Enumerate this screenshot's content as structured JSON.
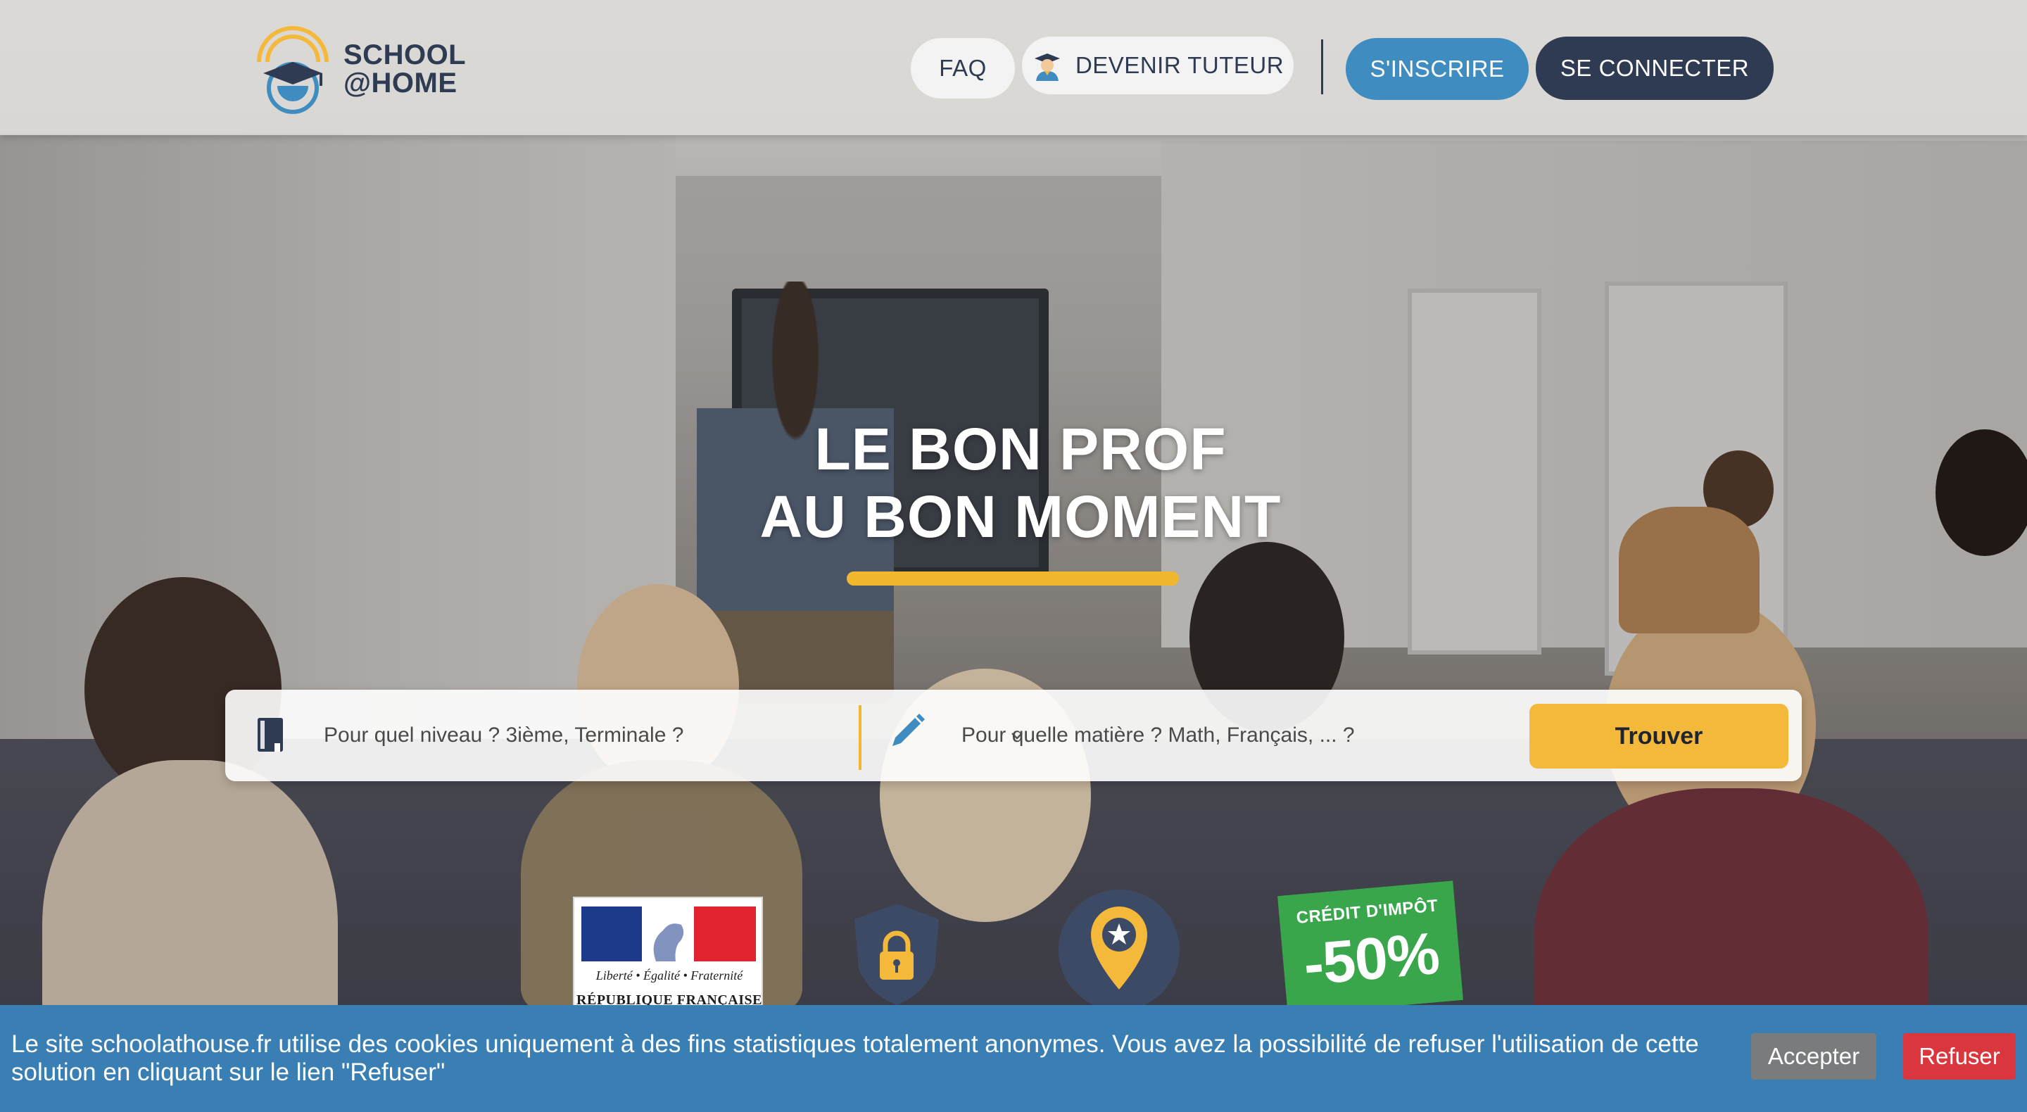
{
  "header": {
    "logo_line1": "SCHOOL",
    "logo_line2": "@HOME",
    "nav": {
      "faq": "FAQ",
      "become_tutor": "DEVENIR TUTEUR",
      "register": "S'INSCRIRE",
      "login": "SE CONNECTER"
    }
  },
  "hero": {
    "title_line1": "LE BON PROF",
    "title_line2": "AU BON MOMENT"
  },
  "search": {
    "level_placeholder": "Pour quel niveau ? 3ième, Terminale ?",
    "subject_placeholder": "Pour quelle matière ? Math, Français, ... ?",
    "submit_label": "Trouver"
  },
  "badges": {
    "republic_motto": "Liberté • Égalité • Fraternité",
    "republic_name": "RÉPUBLIQUE FRANÇAISE",
    "tax_credit_label": "CRÉDIT D'IMPÔT",
    "tax_credit_value": "-50%"
  },
  "cookie_banner": {
    "message": "Le site schoolathouse.fr utilise des cookies uniquement à des fins statistiques totalement anonymes. Vous avez la possibilité de refuser l'utilisation de cette solution en cliquant sur le lien \"Refuser\"",
    "accept_label": "Accepter",
    "refuse_label": "Refuser"
  },
  "colors": {
    "brand_dark": "#2f3b52",
    "brand_blue": "#3f8cc0",
    "accent_yellow": "#f4b83a",
    "cookie_bg": "#3a7fb3",
    "refuse_red": "#d9363e"
  },
  "icons": {
    "level_field": "book-icon",
    "subject_field": "pencil-icon",
    "dropdown": "chevron-down-icon",
    "tutor": "graduate-avatar-icon",
    "security_badge": "lock-shield-icon",
    "location_badge": "star-pin-icon"
  }
}
